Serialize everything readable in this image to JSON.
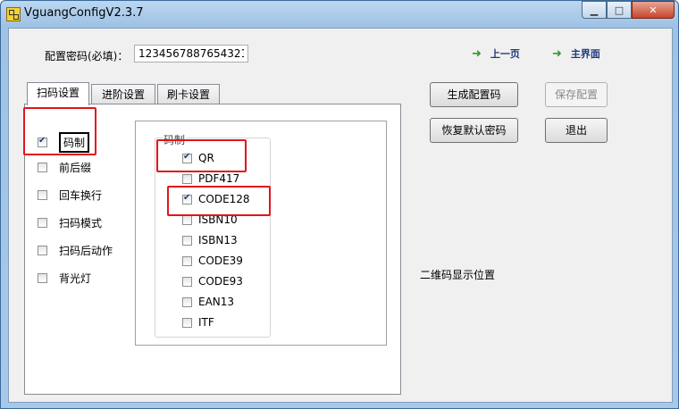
{
  "window": {
    "title": "VguangConfigV2.3.7"
  },
  "top": {
    "password_label": "配置密码(必填)：",
    "password_value": "1234567887654321",
    "prev_link": "上一页",
    "main_link": "主界面"
  },
  "tabs": [
    {
      "label": "扫码设置",
      "active": true
    },
    {
      "label": "进阶设置",
      "active": false
    },
    {
      "label": "刷卡设置",
      "active": false
    }
  ],
  "categories": [
    {
      "label": "码制",
      "checked": true
    },
    {
      "label": "前后缀",
      "checked": false
    },
    {
      "label": "回车换行",
      "checked": false
    },
    {
      "label": "扫码模式",
      "checked": false
    },
    {
      "label": "扫码后动作",
      "checked": false
    },
    {
      "label": "背光灯",
      "checked": false
    }
  ],
  "symbology": {
    "title": "码制",
    "items": [
      {
        "label": "QR",
        "checked": true
      },
      {
        "label": "PDF417",
        "checked": false
      },
      {
        "label": "CODE128",
        "checked": true
      },
      {
        "label": "ISBN10",
        "checked": false
      },
      {
        "label": "ISBN13",
        "checked": false
      },
      {
        "label": "CODE39",
        "checked": false
      },
      {
        "label": "CODE93",
        "checked": false
      },
      {
        "label": "EAN13",
        "checked": false
      },
      {
        "label": "ITF",
        "checked": false
      }
    ]
  },
  "buttons": {
    "generate": "生成配置码",
    "save": "保存配置",
    "restore": "恢复默认密码",
    "exit": "退出"
  },
  "qr_position_label": "二维码显示位置",
  "colors": {
    "highlight": "#e0161b",
    "title_bar": "#a8c8ea"
  }
}
